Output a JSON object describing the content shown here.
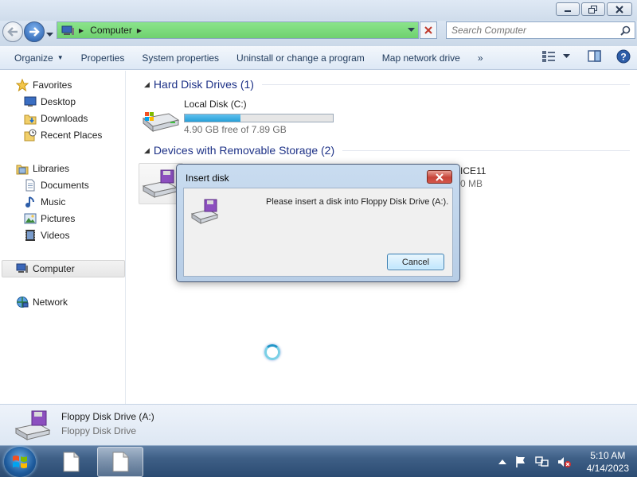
{
  "window": {
    "address": {
      "location": "Computer"
    },
    "search": {
      "placeholder": "Search Computer"
    }
  },
  "toolbar": {
    "organize": "Organize",
    "properties": "Properties",
    "system_properties": "System properties",
    "uninstall": "Uninstall or change a program",
    "map_network_drive": "Map network drive",
    "more": "»"
  },
  "sidebar": {
    "favorites": "Favorites",
    "desktop": "Desktop",
    "downloads": "Downloads",
    "recent_places": "Recent Places",
    "libraries": "Libraries",
    "documents": "Documents",
    "music": "Music",
    "pictures": "Pictures",
    "videos": "Videos",
    "computer": "Computer",
    "network": "Network"
  },
  "content": {
    "hard_disk_header": "Hard Disk Drives (1)",
    "local_disk": {
      "name": "Local Disk (C:)",
      "free_text": "4.90 GB free of 7.89 GB",
      "used_fraction": 0.379
    },
    "removable_header": "Devices with Removable Storage (2)",
    "partial_name": "ICE11",
    "partial_size": "0 MB"
  },
  "details": {
    "name": "Floppy Disk Drive (A:)",
    "type": "Floppy Disk Drive"
  },
  "dialog": {
    "title": "Insert disk",
    "message": "Please insert a disk into Floppy Disk Drive (A:).",
    "cancel": "Cancel"
  },
  "taskbar": {
    "time": "5:10 AM",
    "date": "4/14/2023"
  },
  "colors": {
    "address_bar": "#7bd97b",
    "disk_fill": "#27a0d8",
    "header_text": "#1e3287",
    "close_red": "#c7443a"
  }
}
